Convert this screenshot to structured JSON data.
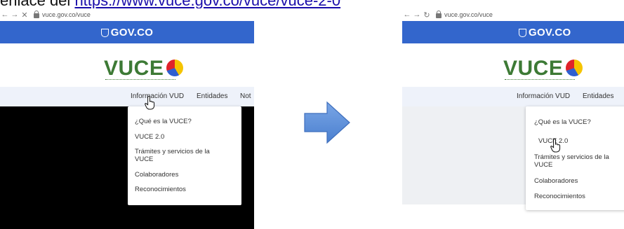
{
  "top_line": {
    "prefix": "enlace del",
    "link": "https://www.vuce.gov.co/vuce/vuce-2-0"
  },
  "left_panel": {
    "url": "vuce.gov.co/vuce",
    "gov_label": "GOV.CO",
    "logo_text": "VUCE",
    "menu": [
      "Información VUD",
      "Entidades",
      "Not"
    ],
    "dropdown": [
      "¿Qué es la VUCE?",
      "VUCE 2.0",
      "Trámites y servicios de la VUCE",
      "Colaboradores",
      "Reconocimientos"
    ]
  },
  "right_panel": {
    "url": "vuce.gov.co/vuce",
    "gov_label": "GOV.CO",
    "logo_text": "VUCE",
    "menu": [
      "Información VUD",
      "Entidades"
    ],
    "dropdown": [
      "¿Qué es la VUCE?",
      "VUCE 2.0",
      "Trámites y servicios de la VUCE",
      "Colaboradores",
      "Reconocimientos"
    ]
  },
  "colors": {
    "gov_blue": "#3366cc",
    "vuce_green": "#3d7a35",
    "link_blue": "#1a0dab",
    "arrow_blue": "#5b8fd8"
  },
  "icons": [
    "back-arrow-icon",
    "forward-arrow-icon",
    "close-icon",
    "reload-icon",
    "lock-icon",
    "gov-shield-icon",
    "hand-pointer-icon",
    "right-arrow-icon"
  ]
}
